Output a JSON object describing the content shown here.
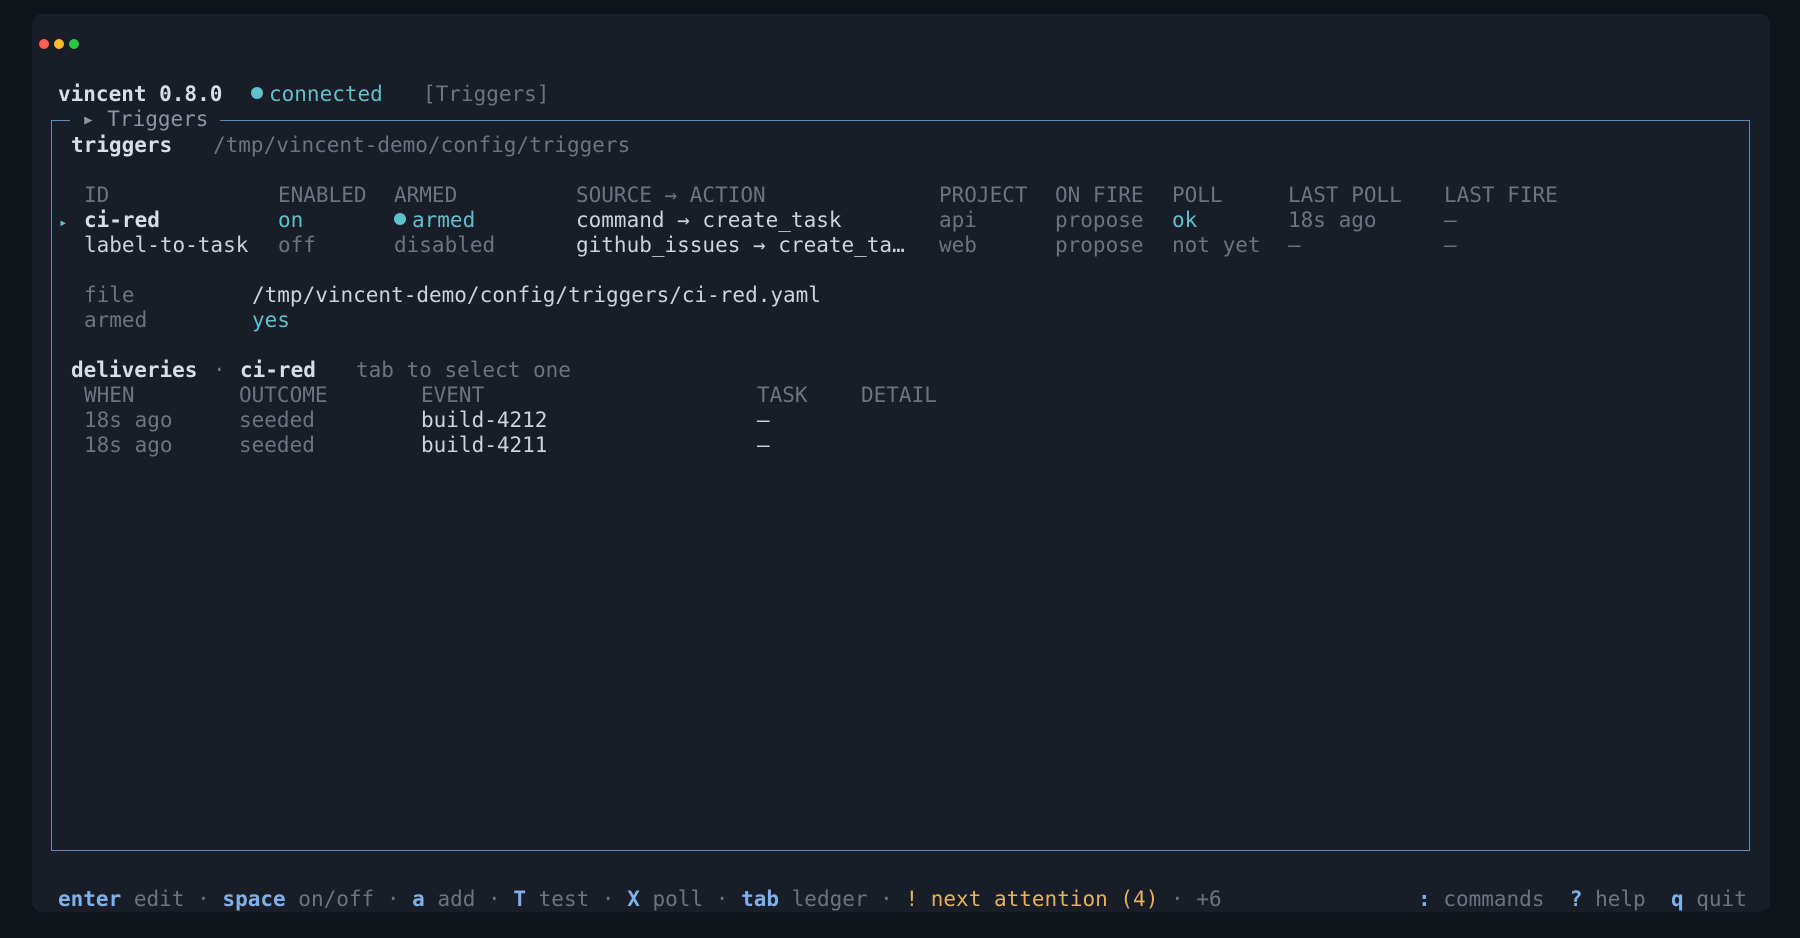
{
  "window": {
    "controls": [
      "close",
      "minimize",
      "maximize"
    ],
    "colors": {
      "close": "#ff5f57",
      "minimize": "#febc2e",
      "maximize": "#28c840"
    }
  },
  "header": {
    "app": "vincent 0.8.0",
    "status": "connected",
    "view": "[Triggers]"
  },
  "panel": {
    "title": "▸ Triggers",
    "section_title": "triggers",
    "path": "/tmp/vincent-demo/config/triggers"
  },
  "table": {
    "columns": [
      "ID",
      "ENABLED",
      "ARMED",
      "SOURCE → ACTION",
      "PROJECT",
      "ON FIRE",
      "POLL",
      "LAST POLL",
      "LAST FIRE"
    ],
    "rows": [
      {
        "id": "ci-red",
        "enabled": "on",
        "armed": "armed",
        "source_action": "command → create_task",
        "project": "api",
        "on_fire": "propose",
        "poll": "ok",
        "last_poll": "18s ago",
        "last_fire": "–"
      },
      {
        "id": "label-to-task",
        "enabled": "off",
        "armed": "disabled",
        "source_action": "github_issues → create_ta…",
        "project": "web",
        "on_fire": "propose",
        "poll": "not yet",
        "last_poll": "–",
        "last_fire": "–"
      }
    ],
    "selected_marker": "▸"
  },
  "detail": {
    "file_label": "file",
    "file_value": "/tmp/vincent-demo/config/triggers/ci-red.yaml",
    "armed_label": "armed",
    "armed_value": "yes"
  },
  "deliveries": {
    "title": "deliveries",
    "separator": "·",
    "trigger": "ci-red",
    "hint": "tab to select one",
    "columns": [
      "WHEN",
      "OUTCOME",
      "EVENT",
      "TASK",
      "DETAIL"
    ],
    "rows": [
      {
        "when": "18s ago",
        "outcome": "seeded",
        "event": "build-4212",
        "task": "–",
        "detail": ""
      },
      {
        "when": "18s ago",
        "outcome": "seeded",
        "event": "build-4211",
        "task": "–",
        "detail": ""
      }
    ]
  },
  "footer": {
    "sep": "·",
    "keys": [
      {
        "key": "enter",
        "label": "edit"
      },
      {
        "key": "space",
        "label": "on/off"
      },
      {
        "key": "a",
        "label": "add"
      },
      {
        "key": "T",
        "label": "test"
      },
      {
        "key": "X",
        "label": "poll"
      },
      {
        "key": "tab",
        "label": "ledger"
      }
    ],
    "attention": "! next attention (4)",
    "more": "+6",
    "right": [
      {
        "key": ":",
        "label": "commands"
      },
      {
        "key": "?",
        "label": "help"
      },
      {
        "key": "q",
        "label": "quit"
      }
    ]
  }
}
